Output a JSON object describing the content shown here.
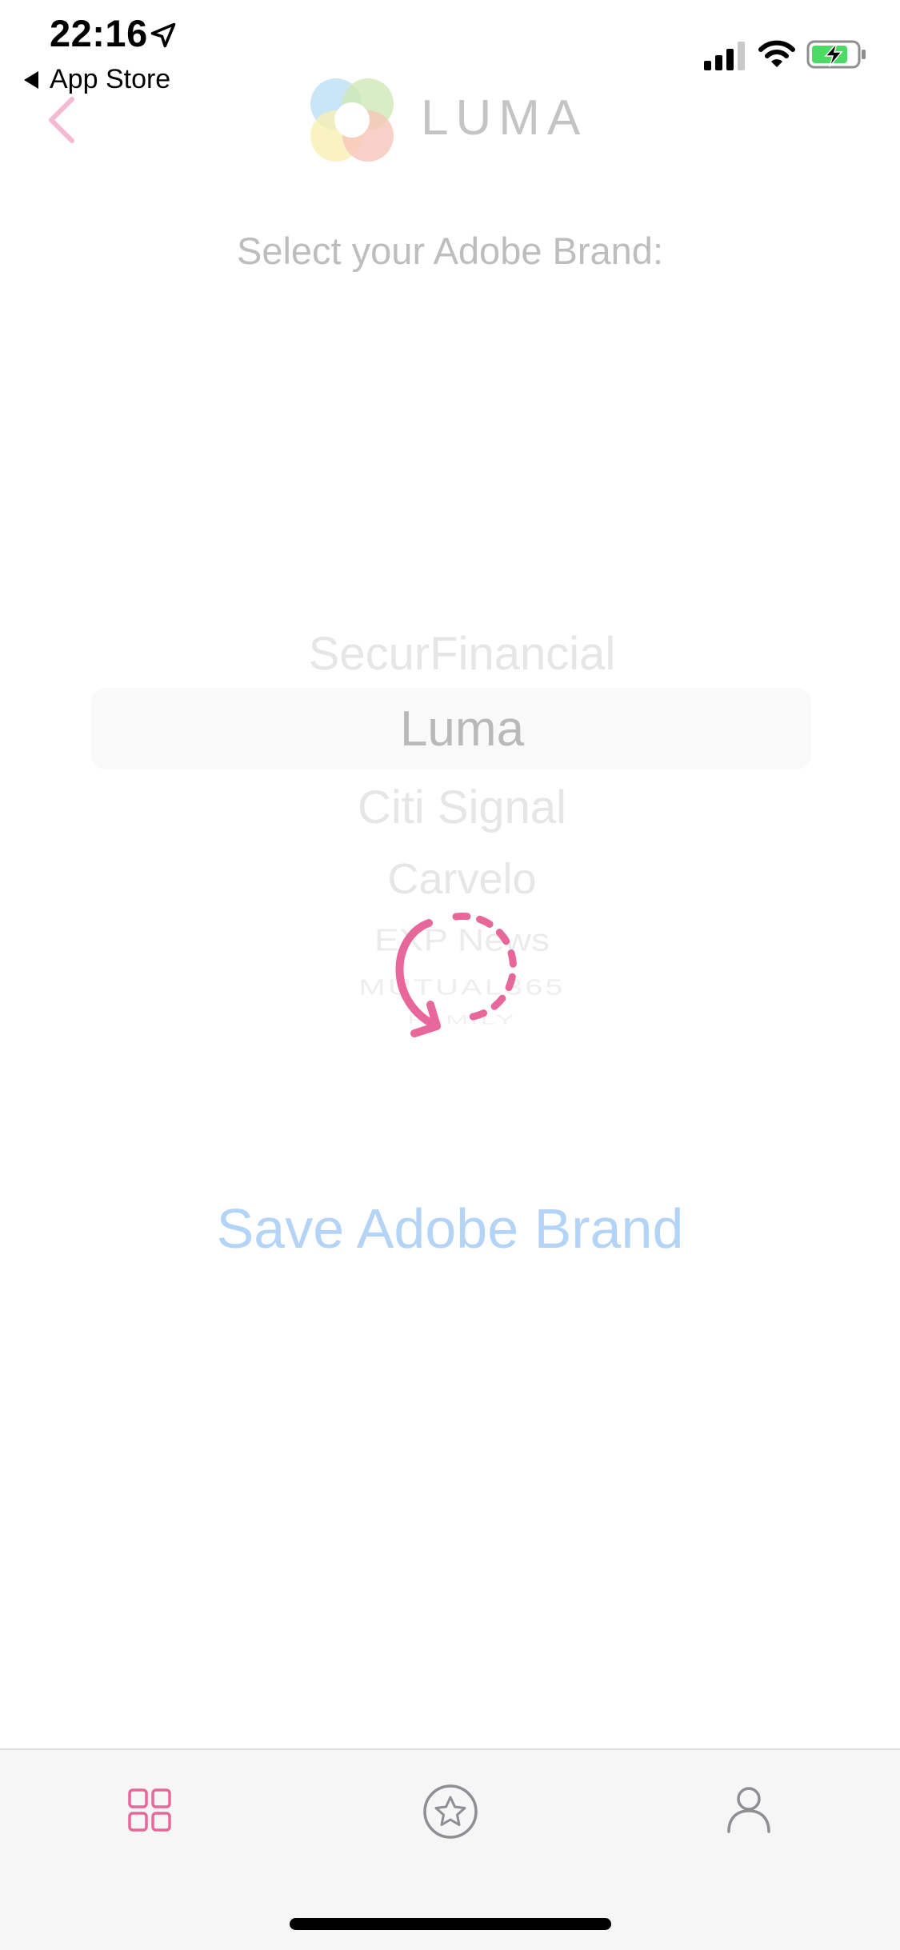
{
  "status_bar": {
    "time": "22:16",
    "back_app": "App Store"
  },
  "header": {
    "logo_text": "LUMA"
  },
  "prompt": "Select your Adobe Brand:",
  "picker": {
    "options": [
      "SecurFinancial",
      "Luma",
      "Citi Signal",
      "Carvelo",
      "EXP News",
      "MUTUAL365",
      "FAMILY"
    ],
    "selected": "Luma"
  },
  "save_button": "Save Adobe Brand",
  "colors": {
    "accent_pink": "#e8679a",
    "button_blue": "#b3d3f7"
  },
  "tab_bar": {
    "tabs": [
      {
        "icon": "grid-icon",
        "active": true
      },
      {
        "icon": "star-icon",
        "active": false
      },
      {
        "icon": "person-icon",
        "active": false
      }
    ]
  }
}
